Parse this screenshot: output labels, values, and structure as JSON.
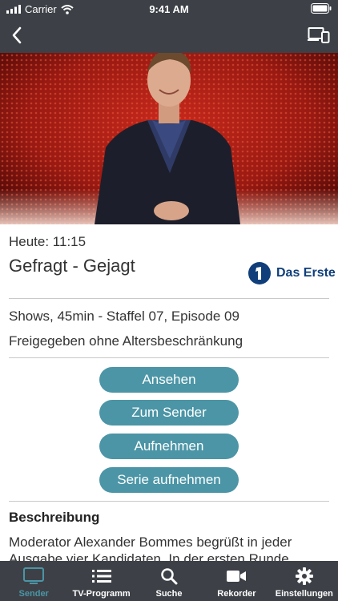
{
  "status_bar": {
    "carrier": "Carrier",
    "time": "9:41 AM"
  },
  "nav": {
    "back_icon": "chevron-left-icon",
    "cast_icon": "devices-icon"
  },
  "program": {
    "airtime": "Heute: 11:15",
    "title": "Gefragt - Gejagt",
    "channel": "Das Erste",
    "info": "Shows, 45min - Staffel 07, Episode 09",
    "rating": "Freigegeben ohne Altersbeschränkung"
  },
  "actions": {
    "watch": "Ansehen",
    "to_channel": "Zum Sender",
    "record": "Aufnehmen",
    "record_series": "Serie aufnehmen"
  },
  "description": {
    "heading": "Beschreibung",
    "text": "Moderator Alexander Bommes begrüßt in jeder Ausgabe vier Kandidaten. In der ersten Runde werden"
  },
  "tabs": [
    {
      "label": "Sender",
      "icon": "tv-icon",
      "active": true
    },
    {
      "label": "TV-Programm",
      "icon": "list-icon",
      "active": false
    },
    {
      "label": "Suche",
      "icon": "search-icon",
      "active": false
    },
    {
      "label": "Rekorder",
      "icon": "video-camera-icon",
      "active": false
    },
    {
      "label": "Einstellungen",
      "icon": "gear-icon",
      "active": false
    }
  ],
  "colors": {
    "bar": "#3d4147",
    "accent": "#4b95a6",
    "channel_blue": "#0f3e7a"
  }
}
